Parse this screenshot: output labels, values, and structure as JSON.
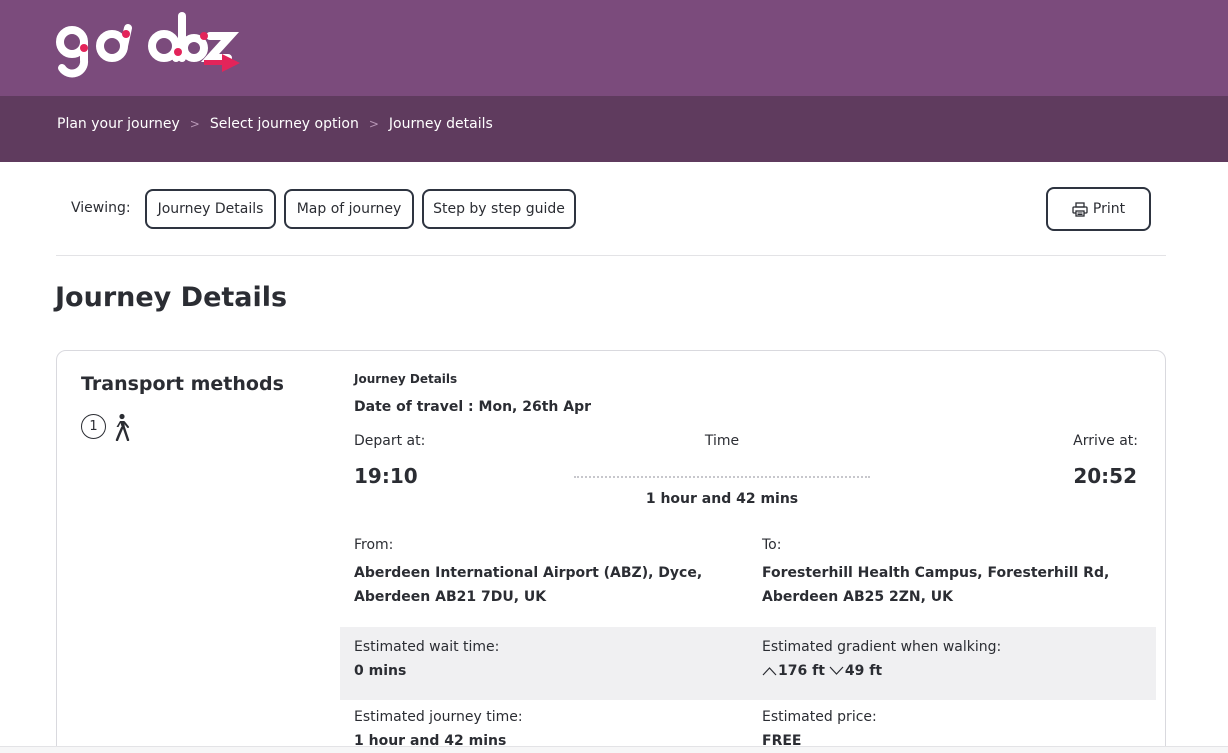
{
  "header": {
    "logo_text": "go abz",
    "brand_color": "#7b4b7c",
    "accent_color": "#e3245a"
  },
  "breadcrumb": {
    "items": [
      "Plan your journey",
      "Select journey option",
      "Journey details"
    ],
    "separator": ">"
  },
  "viewing": {
    "label": "Viewing:",
    "tabs": [
      "Journey Details",
      "Map of journey",
      "Step by step guide"
    ],
    "print_label": "Print",
    "print_icon": "printer-icon"
  },
  "page": {
    "title": "Journey Details"
  },
  "transport": {
    "title": "Transport methods",
    "step_number": "1",
    "mode_icon": "walking-icon"
  },
  "journey": {
    "heading": "Journey Details",
    "date": "Date of travel : Mon, 26th Apr",
    "depart_label": "Depart at:",
    "time_label": "Time",
    "arrive_label": "Arrive at:",
    "depart_time": "19:10",
    "arrive_time": "20:52",
    "duration": "1 hour and 42 mins",
    "from_label": "From:",
    "from_value": "Aberdeen International Airport (ABZ), Dyce, Aberdeen AB21 7DU, UK",
    "to_label": "To:",
    "to_value": "Foresterhill Health Campus, Foresterhill Rd, Aberdeen AB25 2ZN, UK",
    "wait_label": "Estimated wait time:",
    "wait_value": "0 mins",
    "gradient_label": "Estimated gradient when walking:",
    "gradient_up": "176 ft",
    "gradient_down": "49 ft",
    "journey_time_label": "Estimated journey time:",
    "journey_time_value": "1 hour and 42 mins",
    "price_label": "Estimated price:",
    "price_value": "FREE"
  }
}
